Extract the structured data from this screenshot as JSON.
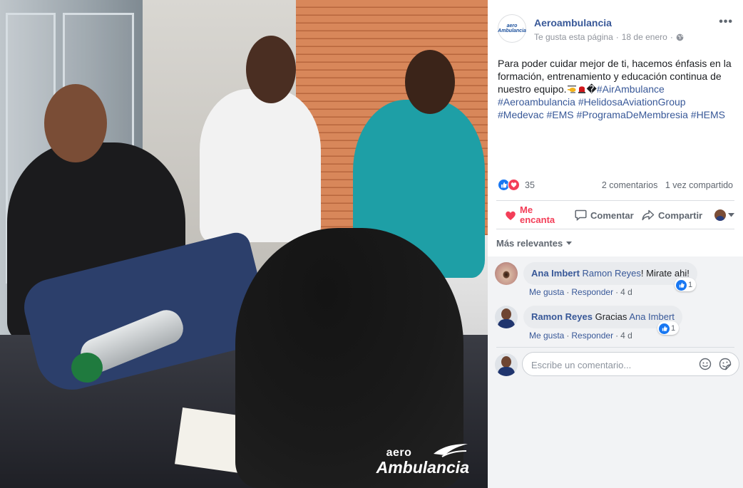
{
  "photo": {
    "logo_line1": "aero",
    "logo_line2": "Ambulancia"
  },
  "post": {
    "page_name": "Aeroambulancia",
    "avatar_text": "aero Ambulancia",
    "liked_page": "Te gusta esta página",
    "date": "18 de enero",
    "text_main": "Para poder cuidar mejor de ti, hacemos énfasis en la formación, entrenamiento y educación continua de nuestro equipo.",
    "text_emoji_tail": "�",
    "hashtags_line1": "#AirAmbulance",
    "hashtags_line2": "#Aeroambulancia #HelidosaAviationGroup",
    "hashtags_line3": "#Medevac #EMS #ProgramaDeMembresia #HEMS"
  },
  "stats": {
    "reaction_count": "35",
    "comments": "2 comentarios",
    "shares": "1 vez compartido"
  },
  "actions": {
    "love_line1": "Me",
    "love_line2": "encanta",
    "comment": "Comentar",
    "share": "Compartir"
  },
  "sort": {
    "label": "Más relevantes"
  },
  "comments": [
    {
      "author": "Ana Imbert",
      "mention": "Ramon Reyes",
      "text": "! Mirate ahi!",
      "like_label": "Me gusta",
      "reply_label": "Responder",
      "time": "4 d",
      "likes": "1"
    },
    {
      "author": "Ramon Reyes",
      "text_before": "Gracias",
      "mention": "Ana Imbert",
      "like_label": "Me gusta",
      "reply_label": "Responder",
      "time": "4 d",
      "likes": "1"
    }
  ],
  "composer": {
    "placeholder": "Escribe un comentario..."
  },
  "colors": {
    "link": "#385898",
    "love": "#f33e58",
    "like": "#1877f2",
    "muted": "#606770"
  },
  "icons": [
    "globe-icon",
    "more-icon",
    "like-reaction-icon",
    "love-reaction-icon",
    "heart-icon",
    "comment-icon",
    "share-icon",
    "caret-down-icon",
    "emoji-icon",
    "sticker-icon"
  ]
}
